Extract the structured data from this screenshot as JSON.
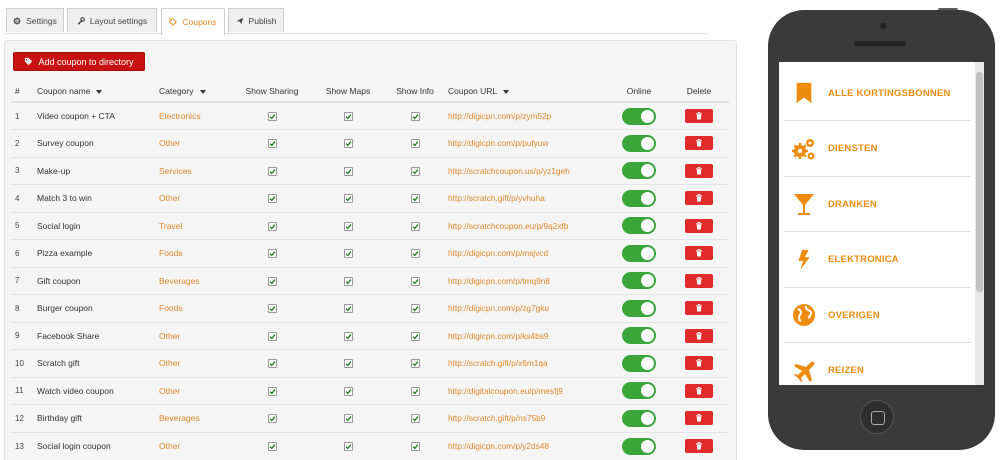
{
  "tabs": [
    {
      "label": "Settings",
      "icon": "gear-icon"
    },
    {
      "label": "Layout settings",
      "icon": "wrench-icon"
    },
    {
      "label": "Coupons",
      "icon": "tag-icon"
    },
    {
      "label": "Publish",
      "icon": "send-icon"
    }
  ],
  "active_tab": "Coupons",
  "add_button": "Add coupon to directory",
  "columns": {
    "num": "#",
    "name": "Coupon name",
    "category": "Category",
    "sharing": "Show Sharing",
    "maps": "Show Maps",
    "info": "Show Info",
    "url": "Coupon URL",
    "online": "Online",
    "delete": "Delete"
  },
  "rows": [
    {
      "num": "1",
      "name": "Video coupon + CTA",
      "category": "Electronics",
      "url": "http://digicpn.com/p/zym52p",
      "sharing": true,
      "maps": true,
      "info": true,
      "online": true
    },
    {
      "num": "2",
      "name": "Survey coupon",
      "category": "Other",
      "url": "http://digicpn.com/p/pufyuw",
      "sharing": true,
      "maps": true,
      "info": true,
      "online": true
    },
    {
      "num": "3",
      "name": "Make-up",
      "category": "Services",
      "url": "http://scratchcoupon.us/p/yz1geh",
      "sharing": true,
      "maps": true,
      "info": true,
      "online": true
    },
    {
      "num": "4",
      "name": "Match 3 to win",
      "category": "Other",
      "url": "http://scratch.gift/p/yvhuha",
      "sharing": true,
      "maps": true,
      "info": true,
      "online": true
    },
    {
      "num": "5",
      "name": "Social login",
      "category": "Travel",
      "url": "http://scratchcoupon.eu/p/9q2xfb",
      "sharing": true,
      "maps": true,
      "info": true,
      "online": true
    },
    {
      "num": "6",
      "name": "Pizza example",
      "category": "Foods",
      "url": "http://digicpn.com/p/msjvcd",
      "sharing": true,
      "maps": true,
      "info": true,
      "online": true
    },
    {
      "num": "7",
      "name": "Gift coupon",
      "category": "Beverages",
      "url": "http://digicpn.com/p/tmq9n8",
      "sharing": true,
      "maps": true,
      "info": true,
      "online": true
    },
    {
      "num": "8",
      "name": "Burger coupon",
      "category": "Foods",
      "url": "http://digicpn.com/p/zg7gku",
      "sharing": true,
      "maps": true,
      "info": true,
      "online": true
    },
    {
      "num": "9",
      "name": "Facebook Share",
      "category": "Other",
      "url": "http://digicpn.com/p/ks4bs9",
      "sharing": true,
      "maps": true,
      "info": true,
      "online": true
    },
    {
      "num": "10",
      "name": "Scratch gift",
      "category": "Other",
      "url": "http://scratch.gift/p/x6m1qa",
      "sharing": true,
      "maps": true,
      "info": true,
      "online": true
    },
    {
      "num": "11",
      "name": "Watch video coupon",
      "category": "Other",
      "url": "http://digitalcoupon.eu/p/mesfj9",
      "sharing": true,
      "maps": true,
      "info": true,
      "online": true
    },
    {
      "num": "12",
      "name": "Birthday gift",
      "category": "Beverages",
      "url": "http://scratch.gift/p/ns75b9",
      "sharing": true,
      "maps": true,
      "info": true,
      "online": true
    },
    {
      "num": "13",
      "name": "Social login coupon",
      "category": "Other",
      "url": "http://digicpn.com/p/y2ds48",
      "sharing": true,
      "maps": true,
      "info": true,
      "online": true
    }
  ],
  "phone_menu": [
    {
      "label": "ALLE KORTINGSBONNEN",
      "icon": "bookmark-icon"
    },
    {
      "label": "DIENSTEN",
      "icon": "gears-icon"
    },
    {
      "label": "DRANKEN",
      "icon": "cocktail-icon"
    },
    {
      "label": "ELEKTRONICA",
      "icon": "lightning-icon"
    },
    {
      "label": "OVERIGEN",
      "icon": "globe-icon"
    },
    {
      "label": "REIZEN",
      "icon": "airplane-icon"
    }
  ],
  "colors": {
    "accent": "#ee8c10",
    "add_button": "#c81212",
    "toggle_on": "#3aa63a",
    "delete": "#e12b2b"
  }
}
